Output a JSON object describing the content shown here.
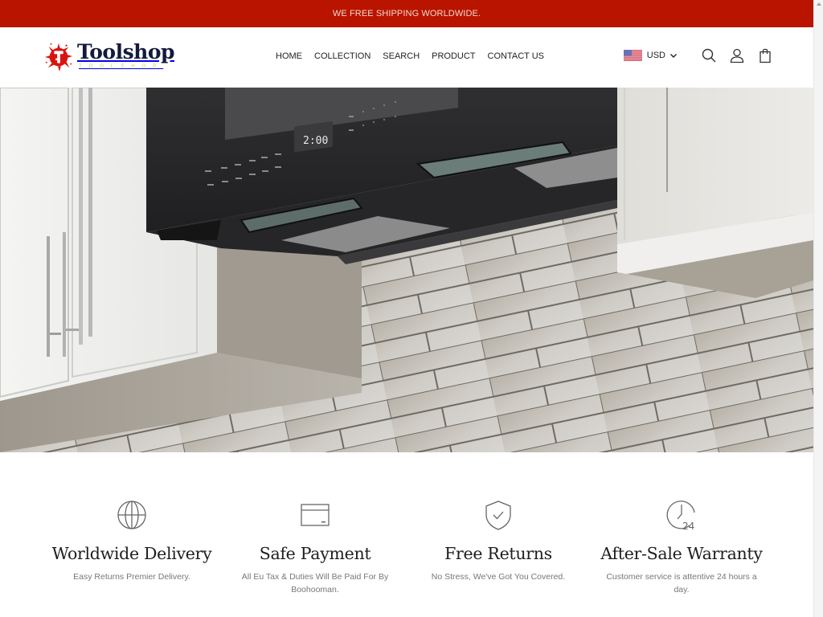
{
  "announcement": {
    "text": "WE FREE SHIPPING WORLDWIDE."
  },
  "brand": {
    "name": "Toolshop",
    "tagline": "TOOLSHOP",
    "accent_color": "#b91400"
  },
  "nav": {
    "items": [
      {
        "label": "HOME"
      },
      {
        "label": "COLLECTION"
      },
      {
        "label": "SEARCH"
      },
      {
        "label": "PRODUCT"
      },
      {
        "label": "CONTACT US"
      }
    ]
  },
  "header_tools": {
    "currency": {
      "selected": "USD",
      "flag": "us-flag-icon"
    },
    "icons": [
      "search-icon",
      "account-icon",
      "cart-bag-icon"
    ]
  },
  "hero": {
    "image_alt": "Black over-the-range microwave mounted under white kitchen cabinets with subway tile backsplash",
    "display_time": "2:00"
  },
  "features": [
    {
      "icon": "globe-icon",
      "title": "Worldwide Delivery",
      "description": "Easy Returns Premier Delivery."
    },
    {
      "icon": "credit-card-icon",
      "title": "Safe Payment",
      "description": "All Eu Tax & Duties Will Be Paid For By Boohooman."
    },
    {
      "icon": "shield-check-icon",
      "title": "Free Returns",
      "description": "No Stress, We've Got You Covered."
    },
    {
      "icon": "clock-24-icon",
      "title": "After-Sale Warranty",
      "description": "Customer service is attentive 24 hours a day."
    }
  ]
}
